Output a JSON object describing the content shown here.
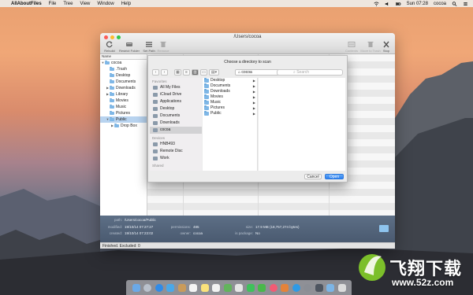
{
  "menubar": {
    "apple": "",
    "items": [
      "AllAboutFiles",
      "File",
      "Tree",
      "View",
      "Window",
      "Help"
    ],
    "clock": "Sun 07:28",
    "user": "cocoa"
  },
  "window": {
    "title": "/Users/cocoa",
    "toolbar": [
      {
        "label": "Rebuild",
        "icon": "refresh-icon"
      },
      {
        "label": "Restrict Folder",
        "icon": "drive-icon"
      },
      {
        "label": "Set Path",
        "icon": "list-icon"
      },
      {
        "label": "Remove",
        "icon": "trash-icon"
      }
    ],
    "toolbar_right": [
      {
        "label": "Contents",
        "icon": "contents-icon"
      },
      {
        "label": "Move to Trash",
        "icon": "trash-icon"
      },
      {
        "label": "Stop",
        "icon": "close-icon"
      }
    ],
    "column_header": "Name",
    "tree": [
      {
        "label": "cocoa",
        "depth": 0,
        "open": true
      },
      {
        "label": ".Trash",
        "depth": 1
      },
      {
        "label": "Desktop",
        "depth": 1
      },
      {
        "label": "Documents",
        "depth": 1
      },
      {
        "label": "Downloads",
        "depth": 1,
        "collapsed": true
      },
      {
        "label": "Library",
        "depth": 1,
        "collapsed": true
      },
      {
        "label": "Movies",
        "depth": 1
      },
      {
        "label": "Music",
        "depth": 1
      },
      {
        "label": "Pictures",
        "depth": 1
      },
      {
        "label": "Public",
        "depth": 1,
        "open": true,
        "selected": true
      },
      {
        "label": "Drop Box",
        "depth": 2,
        "collapsed": true
      }
    ]
  },
  "info": {
    "path_label": "path:",
    "path_value": "/Users/cocoa/Public",
    "modified_label": "modified:",
    "modified_value": "19/10/14 07:27:27",
    "created_label": "created:",
    "created_value": "19/10/14 07:23:02",
    "permissions_label": "permissions:",
    "permissions_value": "485",
    "owner_label": "owner:",
    "owner_value": "cocoa",
    "size_label": "size:",
    "size_value": "17.9 MB  (18,757,274 bytes)",
    "package_label": "is package:",
    "package_value": "No"
  },
  "status": "Finished.  Excluded: 0",
  "dialog": {
    "title": "Choose a directory to scan",
    "location": "cocoa",
    "search_placeholder": "Search",
    "favorites_header": "Favorites",
    "favorites": [
      {
        "label": "All My Files",
        "icon": "all-files-icon"
      },
      {
        "label": "iCloud Drive",
        "icon": "cloud-icon"
      },
      {
        "label": "Applications",
        "icon": "applications-icon"
      },
      {
        "label": "Desktop",
        "icon": "desktop-icon"
      },
      {
        "label": "Documents",
        "icon": "documents-icon"
      },
      {
        "label": "Downloads",
        "icon": "downloads-icon"
      },
      {
        "label": "cocoa",
        "icon": "home-icon",
        "selected": true
      }
    ],
    "devices_header": "Devices",
    "devices": [
      {
        "label": "HNB493",
        "icon": "computer-icon"
      },
      {
        "label": "Remote Disc",
        "icon": "disc-icon"
      },
      {
        "label": "Work",
        "icon": "drive-icon"
      }
    ],
    "shared_header": "Shared",
    "folders": [
      "Desktop",
      "Documents",
      "Downloads",
      "Movies",
      "Music",
      "Pictures",
      "Public"
    ],
    "cancel": "Cancel",
    "open": "Open"
  },
  "watermark": {
    "title": "飞翔下载",
    "url": "www.52z.com"
  },
  "colors": {
    "accent": "#2a7ff0",
    "selection": "#b8d3ef",
    "info_panel": "#536379"
  }
}
